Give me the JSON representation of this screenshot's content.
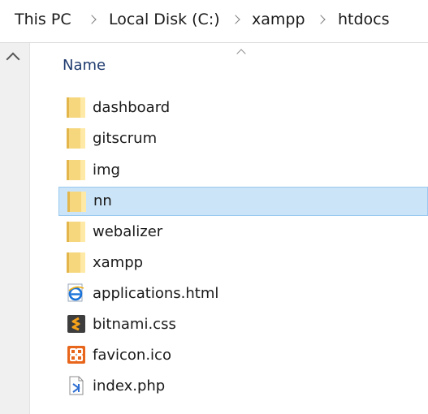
{
  "breadcrumb": [
    "This PC",
    "Local Disk (C:)",
    "xampp",
    "htdocs"
  ],
  "column_header": "Name",
  "files": [
    {
      "name": "dashboard",
      "icon": "folder-icon",
      "selected": false
    },
    {
      "name": "gitscrum",
      "icon": "folder-icon",
      "selected": false
    },
    {
      "name": "img",
      "icon": "folder-icon",
      "selected": false
    },
    {
      "name": "nn",
      "icon": "folder-icon",
      "selected": true
    },
    {
      "name": "webalizer",
      "icon": "folder-icon",
      "selected": false
    },
    {
      "name": "xampp",
      "icon": "folder-icon",
      "selected": false
    },
    {
      "name": "applications.html",
      "icon": "html-file-icon",
      "selected": false
    },
    {
      "name": "bitnami.css",
      "icon": "css-file-icon",
      "selected": false
    },
    {
      "name": "favicon.ico",
      "icon": "ico-file-icon",
      "selected": false
    },
    {
      "name": "index.php",
      "icon": "php-file-icon",
      "selected": false
    }
  ],
  "colors": {
    "selection": "#cce4f7",
    "selection_border": "#99c9ef",
    "folder": "#f6d77e",
    "header_text": "#1e3a6e"
  }
}
